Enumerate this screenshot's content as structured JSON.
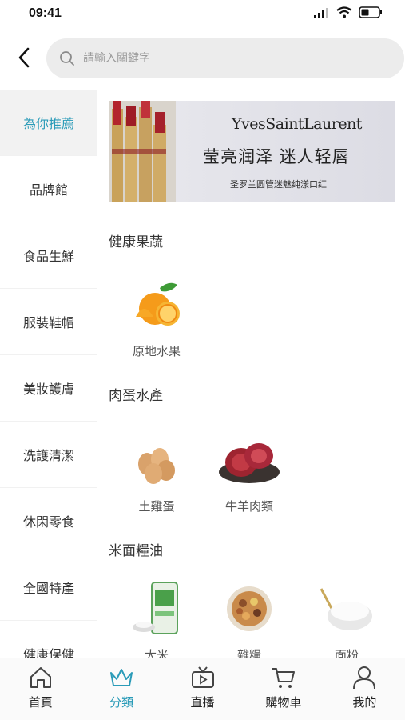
{
  "status_bar": {
    "time": "09:41"
  },
  "search": {
    "placeholder": "請輸入關鍵字"
  },
  "sidebar": {
    "items": [
      {
        "label": "為你推薦",
        "active": true
      },
      {
        "label": "品牌館"
      },
      {
        "label": "食品生鮮"
      },
      {
        "label": "服裝鞋帽"
      },
      {
        "label": "美妝護膚"
      },
      {
        "label": "洗護清潔"
      },
      {
        "label": "休閑零食"
      },
      {
        "label": "全國特產"
      },
      {
        "label": "健康保健"
      }
    ]
  },
  "banner": {
    "brand": "YvesSaintLaurent",
    "title": "莹亮润泽 迷人轻唇",
    "subtitle": "圣罗兰圆管迷魅纯漾口红"
  },
  "sections": [
    {
      "title": "健康果蔬",
      "products": [
        {
          "name": "原地水果",
          "icon": "orange-icon"
        }
      ]
    },
    {
      "title": "肉蛋水產",
      "products": [
        {
          "name": "土雞蛋",
          "icon": "eggs-icon"
        },
        {
          "name": "牛羊肉類",
          "icon": "meat-icon"
        }
      ]
    },
    {
      "title": "米面糧油",
      "products": [
        {
          "name": "大米",
          "icon": "rice-bag-icon"
        },
        {
          "name": "雜糧",
          "icon": "grains-icon"
        },
        {
          "name": "面粉",
          "icon": "flour-icon"
        }
      ]
    }
  ],
  "tabbar": {
    "tabs": [
      {
        "label": "首頁",
        "icon": "home-icon"
      },
      {
        "label": "分類",
        "icon": "crown-icon",
        "active": true
      },
      {
        "label": "直播",
        "icon": "tv-icon"
      },
      {
        "label": "購物車",
        "icon": "cart-icon"
      },
      {
        "label": "我的",
        "icon": "user-icon"
      }
    ]
  },
  "colors": {
    "accent": "#2a9bb8",
    "active_bg": "#f2f2f2",
    "search_bg": "#ececec"
  }
}
